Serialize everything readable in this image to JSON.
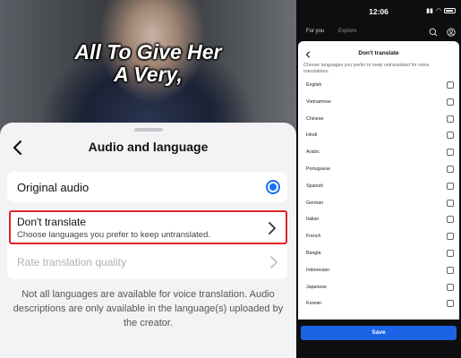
{
  "video": {
    "subtitle_line1": "All To Give Her",
    "subtitle_line2": "A Very,"
  },
  "sheet": {
    "title": "Audio and language",
    "original_audio_label": "Original audio",
    "original_audio_selected": true,
    "dont_translate_title": "Don't translate",
    "dont_translate_subtitle": "Choose languages you prefer to keep untranslated.",
    "rate_label": "Rate translation quality",
    "footnote": "Not all languages are available for voice translation. Audio descriptions are only available in the language(s) uploaded by the creator."
  },
  "phone": {
    "time": "12:06",
    "nav": [
      "For you",
      "Explore"
    ],
    "panel_title": "Don't translate",
    "panel_description": "Choose languages you prefer to keep untranslated for voice translations.",
    "languages": [
      "English",
      "Vietnamese",
      "Chinese",
      "Hindi",
      "Arabic",
      "Portuguese",
      "Spanish",
      "German",
      "Italian",
      "French",
      "Bangla",
      "Indonesian",
      "Japanese",
      "Korean"
    ],
    "save_label": "Save"
  },
  "colors": {
    "accent_blue": "#1a6ef0",
    "highlight_red": "#e0232a",
    "save_blue": "#1d63e6"
  }
}
